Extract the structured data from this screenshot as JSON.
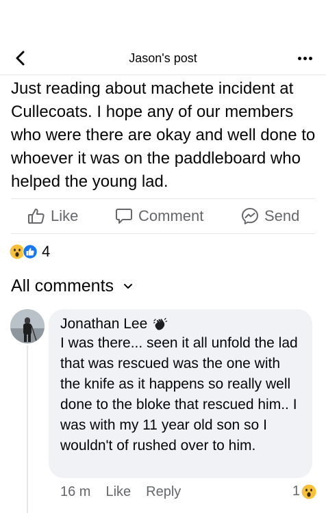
{
  "header": {
    "title": "Jason's post"
  },
  "post": {
    "text": "Just reading about machete incident at Cullecoats. I hope any of our members who were there are okay and well done to whoever it was on the paddleboard who helped the young lad."
  },
  "actions": {
    "like": "Like",
    "comment": "Comment",
    "send": "Send"
  },
  "reactions": {
    "icons": [
      "wow-reaction-icon",
      "like-reaction-icon"
    ],
    "count": "4"
  },
  "comments_section": {
    "heading": "All comments"
  },
  "comment": {
    "author": "Jonathan Lee",
    "badge_icon": "waving-hand-badge-icon",
    "text": "I was there... seen it all unfold the lad that was rescued was the one with the knife as it happens so really well done to the bloke that rescued him.. I was with my 11 year old son so I wouldn't of rushed over to him.",
    "time": "16 m",
    "like": "Like",
    "reply": "Reply",
    "reaction_count": "1",
    "reaction_icon": "wow-reaction-icon"
  },
  "colors": {
    "like_blue": "#1877f2",
    "wow_yellow": "#f7c23a",
    "muted_text": "#65676b",
    "bubble_bg": "#f0f2f5"
  }
}
